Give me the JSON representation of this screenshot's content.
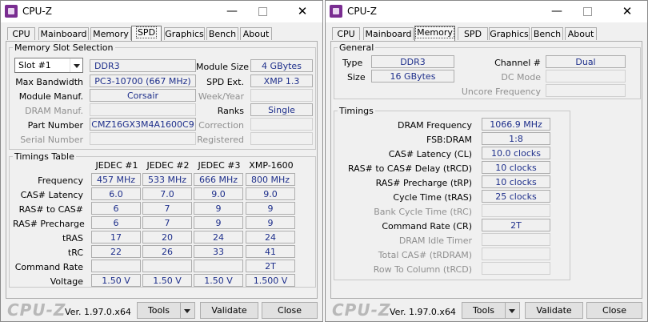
{
  "left": {
    "title": "CPU-Z",
    "tabs": [
      "CPU",
      "Mainboard",
      "Memory",
      "SPD",
      "Graphics",
      "Bench",
      "About"
    ],
    "active_tab": "SPD",
    "slot_group": {
      "legend": "Memory Slot Selection",
      "slot": "Slot #1",
      "memory_type": "DDR3",
      "module_size_label": "Module Size",
      "module_size": "4 GBytes",
      "max_bandwidth_label": "Max Bandwidth",
      "max_bandwidth": "PC3-10700 (667 MHz)",
      "spd_ext_label": "SPD Ext.",
      "spd_ext": "XMP 1.3",
      "manuf_label": "Module Manuf.",
      "manuf": "Corsair",
      "week_year_label": "Week/Year",
      "dram_manuf_label": "DRAM Manuf.",
      "ranks_label": "Ranks",
      "ranks": "Single",
      "part_label": "Part Number",
      "part": "CMZ16GX3M4A1600C9",
      "correction_label": "Correction",
      "serial_label": "Serial Number",
      "registered_label": "Registered"
    },
    "timings": {
      "legend": "Timings Table",
      "columns": [
        "JEDEC #1",
        "JEDEC #2",
        "JEDEC #3",
        "XMP-1600"
      ],
      "rows": [
        {
          "label": "Frequency",
          "values": [
            "457 MHz",
            "533 MHz",
            "666 MHz",
            "800 MHz"
          ]
        },
        {
          "label": "CAS# Latency",
          "values": [
            "6.0",
            "7.0",
            "9.0",
            "9.0"
          ]
        },
        {
          "label": "RAS# to CAS#",
          "values": [
            "6",
            "7",
            "9",
            "9"
          ]
        },
        {
          "label": "RAS# Precharge",
          "values": [
            "6",
            "7",
            "9",
            "9"
          ]
        },
        {
          "label": "tRAS",
          "values": [
            "17",
            "20",
            "24",
            "24"
          ]
        },
        {
          "label": "tRC",
          "values": [
            "22",
            "26",
            "33",
            "41"
          ]
        },
        {
          "label": "Command Rate",
          "values": [
            "",
            "",
            "",
            "2T"
          ]
        },
        {
          "label": "Voltage",
          "values": [
            "1.50 V",
            "1.50 V",
            "1.50 V",
            "1.500 V"
          ]
        }
      ]
    },
    "footer": {
      "brand": "CPU-Z",
      "version": "Ver. 1.97.0.x64",
      "tools": "Tools",
      "validate": "Validate",
      "close": "Close"
    }
  },
  "right": {
    "title": "CPU-Z",
    "tabs": [
      "CPU",
      "Mainboard",
      "Memory",
      "SPD",
      "Graphics",
      "Bench",
      "About"
    ],
    "active_tab": "Memory",
    "general": {
      "legend": "General",
      "type_label": "Type",
      "type": "DDR3",
      "channel_label": "Channel #",
      "channel": "Dual",
      "size_label": "Size",
      "size": "16 GBytes",
      "dc_mode_label": "DC Mode",
      "uncore_label": "Uncore Frequency"
    },
    "timings": {
      "legend": "Timings",
      "rows": [
        {
          "label": "DRAM Frequency",
          "value": "1066.9 MHz",
          "enabled": true
        },
        {
          "label": "FSB:DRAM",
          "value": "1:8",
          "enabled": true
        },
        {
          "label": "CAS# Latency (CL)",
          "value": "10.0 clocks",
          "enabled": true
        },
        {
          "label": "RAS# to CAS# Delay (tRCD)",
          "value": "10 clocks",
          "enabled": true
        },
        {
          "label": "RAS# Precharge (tRP)",
          "value": "10 clocks",
          "enabled": true
        },
        {
          "label": "Cycle Time (tRAS)",
          "value": "25 clocks",
          "enabled": true
        },
        {
          "label": "Bank Cycle Time (tRC)",
          "value": "",
          "enabled": false
        },
        {
          "label": "Command Rate (CR)",
          "value": "2T",
          "enabled": true
        },
        {
          "label": "DRAM Idle Timer",
          "value": "",
          "enabled": false
        },
        {
          "label": "Total CAS# (tRDRAM)",
          "value": "",
          "enabled": false
        },
        {
          "label": "Row To Column (tRCD)",
          "value": "",
          "enabled": false
        }
      ]
    },
    "footer": {
      "brand": "CPU-Z",
      "version": "Ver. 1.97.0.x64",
      "tools": "Tools",
      "validate": "Validate",
      "close": "Close"
    }
  }
}
